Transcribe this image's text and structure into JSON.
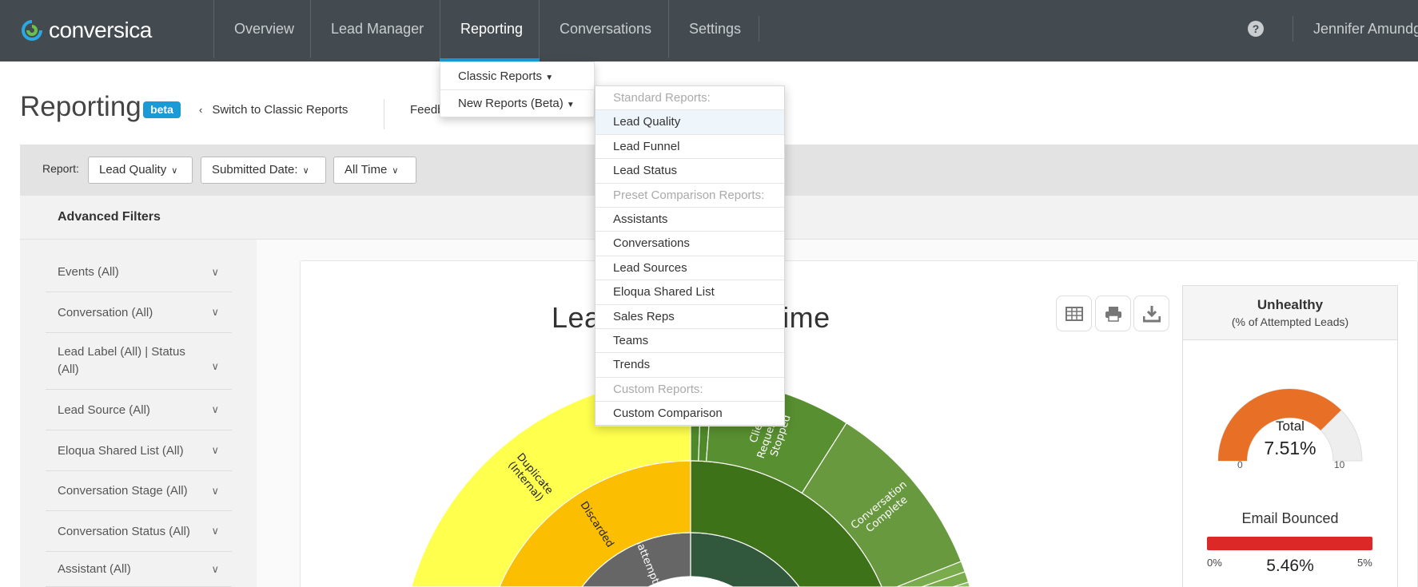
{
  "brand": {
    "name": "conversica"
  },
  "nav": {
    "items": [
      {
        "label": "Overview",
        "active": false
      },
      {
        "label": "Lead Manager",
        "active": false
      },
      {
        "label": "Reporting",
        "active": true
      },
      {
        "label": "Conversations",
        "active": false
      },
      {
        "label": "Settings",
        "active": false
      }
    ],
    "help_icon": "?",
    "user_name": "Jennifer Amundg"
  },
  "header": {
    "title": "Reporting",
    "badge": "beta",
    "switch_link": "Switch to Classic Reports",
    "feedback_link": "Feedback"
  },
  "filters": {
    "report_label": "Report:",
    "report_value": "Lead Quality",
    "date_field": "Submitted Date:",
    "date_range": "All Time",
    "advanced_title": "Advanced Filters",
    "sidebar_items": [
      "Events (All)",
      "Conversation (All)",
      "Lead Label (All) | Status (All)",
      "Lead Source (All)",
      "Eloqua Shared List (All)",
      "Conversation Stage (All)",
      "Conversation Status (All)",
      "Assistant (All)"
    ]
  },
  "reporting_menu": {
    "classic": "Classic Reports",
    "new": "New Reports (Beta)",
    "submenu": [
      {
        "label": "Standard Reports:",
        "header": true
      },
      {
        "label": "Lead Quality",
        "hover": true
      },
      {
        "label": "Lead Funnel"
      },
      {
        "label": "Lead Status"
      },
      {
        "label": "Preset Comparison Reports:",
        "header": true
      },
      {
        "label": "Assistants"
      },
      {
        "label": "Conversations"
      },
      {
        "label": "Lead Sources"
      },
      {
        "label": "Eloqua Shared List"
      },
      {
        "label": "Sales Reps"
      },
      {
        "label": "Teams"
      },
      {
        "label": "Trends"
      },
      {
        "label": "Custom Reports:",
        "header": true
      },
      {
        "label": "Custom Comparison"
      }
    ]
  },
  "chart": {
    "title": "Lead Quality All Time",
    "toolbar_icons": [
      "table-icon",
      "print-icon",
      "download-icon"
    ],
    "sunburst": {
      "rings": [
        {
          "segments": [
            {
              "label": "Unattempted",
              "share": 0.5,
              "color": "#666666"
            },
            {
              "label": "",
              "share": 0.5,
              "color": "#31573c"
            }
          ]
        },
        {
          "segments": [
            {
              "label": "Discarded",
              "share": 0.5,
              "color": "#fcbe00"
            },
            {
              "label": "",
              "share": 0.5,
              "color": "#3e7218"
            }
          ]
        },
        {
          "segments": [
            {
              "label": "Duplicate (Internal)",
              "share": 0.5,
              "color": "#ffff4d"
            },
            {
              "label": "",
              "share": 0.006,
              "color": "#4f8a2a"
            },
            {
              "label": "",
              "share": 0.006,
              "color": "#4f8a2a"
            },
            {
              "label": "Client Requested Stopped",
              "share": 0.078,
              "color": "#588f30"
            },
            {
              "label": "Conversation Complete",
              "share": 0.1,
              "color": "#68993f"
            },
            {
              "label": "",
              "share": 0.006,
              "color": "#7aab4c"
            },
            {
              "label": "",
              "share": 0.006,
              "color": "#7aab4c"
            },
            {
              "label": "",
              "share": 0.298,
              "color": "#8cc063"
            }
          ]
        }
      ]
    }
  },
  "health_panel": {
    "title": "Unhealthy",
    "subtitle": "(% of Attempted Leads)",
    "gauge": {
      "label": "Total",
      "value_text": "7.51%",
      "value": 7.51,
      "min": "0",
      "max": "10",
      "fill_color": "#e87026",
      "track_color": "#eeeeee"
    },
    "email_bounced": {
      "label": "Email Bounced",
      "value_text": "5.46%",
      "min": "0%",
      "max": "5%",
      "bar_color": "#dd2828"
    }
  }
}
